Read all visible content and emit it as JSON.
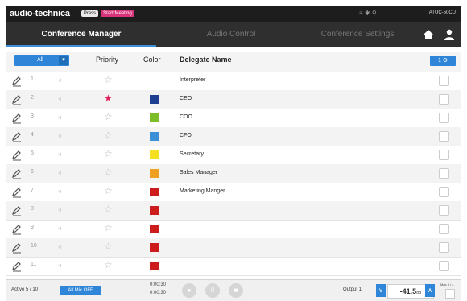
{
  "topbar": {
    "brand": "audio-technica",
    "mode_badge": "Press",
    "mode_status": "Start Meeting",
    "signal": "≡ ✱ ⚲",
    "model": "ATUC-50CU"
  },
  "tabs": [
    {
      "label": "Conference Manager",
      "active": true
    },
    {
      "label": "Audio Control",
      "active": false
    },
    {
      "label": "Conference Settings",
      "active": false
    }
  ],
  "toolbar_icons": [
    "home-icon",
    "user-icon"
  ],
  "header": {
    "filter_label": "All",
    "columns": {
      "priority": "Priority",
      "color": "Color",
      "name": "Delegate Name"
    },
    "pager_label": "1 ⚙"
  },
  "delegates": [
    {
      "seat": "1",
      "priority": false,
      "color": "",
      "name": "Interpreter"
    },
    {
      "seat": "2",
      "priority": true,
      "color": "#1f3f93",
      "name": "CEO"
    },
    {
      "seat": "3",
      "priority": false,
      "color": "#7dbd27",
      "name": "COO"
    },
    {
      "seat": "4",
      "priority": false,
      "color": "#3a8fd6",
      "name": "CFO"
    },
    {
      "seat": "5",
      "priority": false,
      "color": "#f5e020",
      "name": "Secretary"
    },
    {
      "seat": "6",
      "priority": false,
      "color": "#f0a020",
      "name": "Sales Manager"
    },
    {
      "seat": "7",
      "priority": false,
      "color": "#cc1c1c",
      "name": "Marketing Manger"
    },
    {
      "seat": "8",
      "priority": false,
      "color": "#cc1c1c",
      "name": ""
    },
    {
      "seat": "9",
      "priority": false,
      "color": "#cc1c1c",
      "name": ""
    },
    {
      "seat": "10",
      "priority": false,
      "color": "#cc1c1c",
      "name": ""
    },
    {
      "seat": "11",
      "priority": false,
      "color": "#cc1c1c",
      "name": ""
    }
  ],
  "bottom": {
    "active_count": "Active 5 / 10",
    "all_mic_off": "All Mic OFF",
    "timer_1": "0:00:30",
    "timer_2": "0:00:30",
    "output_label": "Output 1",
    "volume_value": "-41.5",
    "volume_unit": "dB",
    "max_label": "Max 4 / 4"
  },
  "colors": {
    "accent": "#2f86d8",
    "topbar": "#1d1d1d",
    "tabbar": "#2f2f2f",
    "priority_on": "#e0245e"
  }
}
